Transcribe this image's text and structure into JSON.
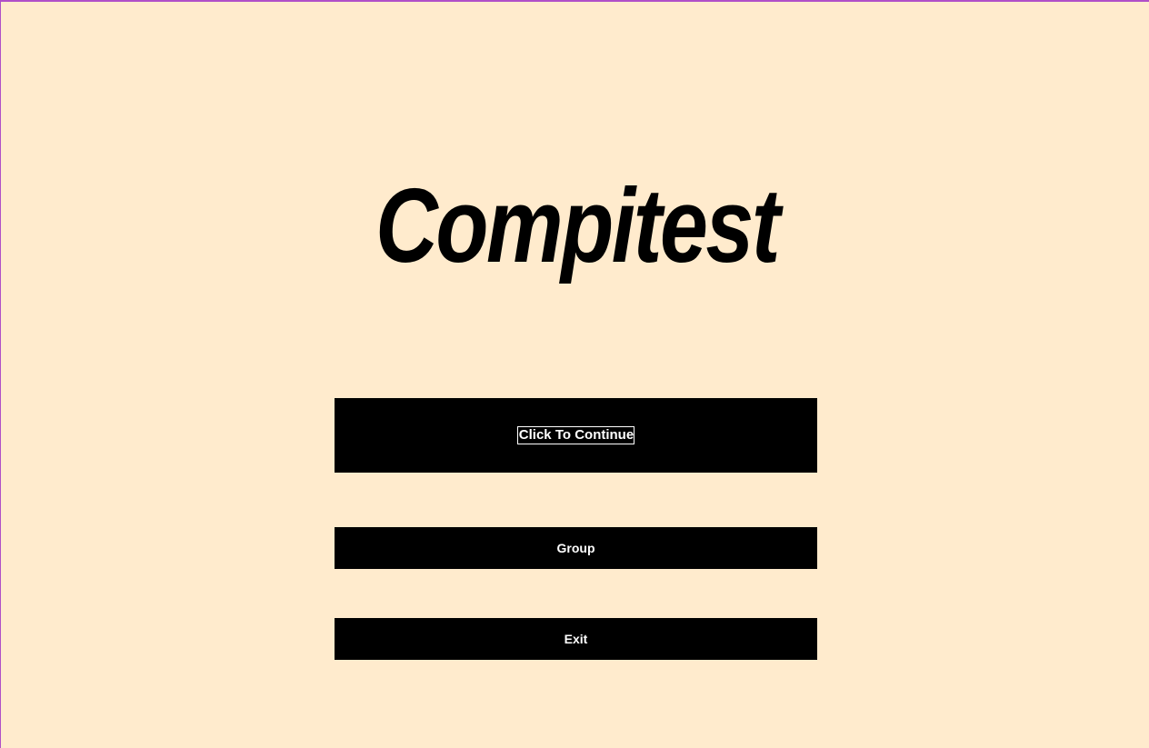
{
  "app": {
    "title": "Compitest",
    "background_color": "#FFEBCD",
    "window_border_color": "#B04FC8"
  },
  "menu": {
    "continue_label": "Click To Continue",
    "group_label": "Group",
    "exit_label": "Exit",
    "button_color": "#000000",
    "button_text_color": "#FFFFFF"
  }
}
